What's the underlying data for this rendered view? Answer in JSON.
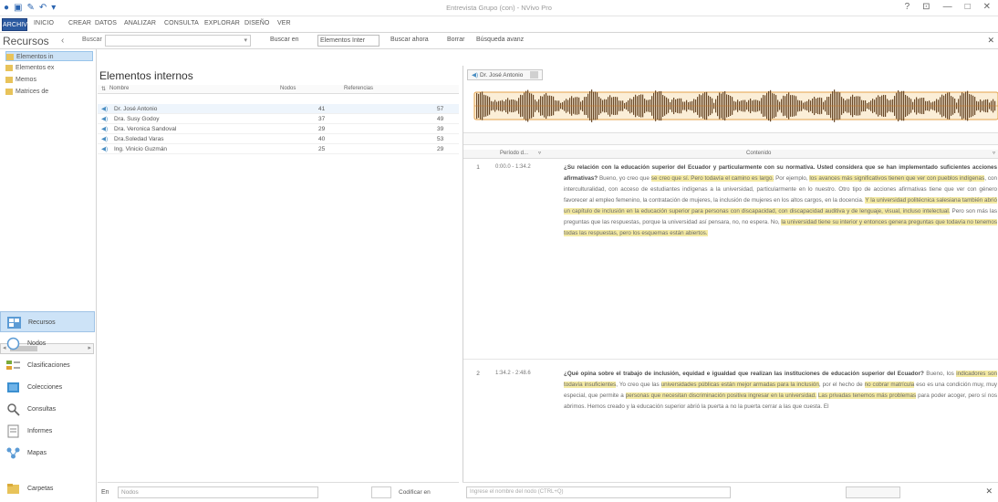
{
  "window": {
    "title": "Entrevista Grupo (con) - NVivo Pro",
    "controls": [
      "?",
      "⊡",
      "—",
      "□",
      "✕"
    ]
  },
  "ribbon": {
    "tabs": [
      "ARCHIVO",
      "INICIO",
      "CREAR",
      "DATOS",
      "ANALIZAR",
      "CONSULTA",
      "EXPLORAR",
      "DISEÑO",
      "VER"
    ]
  },
  "searchbar": {
    "buscar_label": "Buscar",
    "buscar_en": "Buscar en",
    "scope": "Elementos Inter",
    "buscar_ahora": "Buscar ahora",
    "borrar": "Borrar",
    "avanzada": "Búsqueda avanz"
  },
  "nav": {
    "title": "Recursos",
    "tree": [
      "Elementos in",
      "Elementos ex",
      "Memos",
      "Matrices de"
    ],
    "buttons": [
      "Recursos",
      "Nodos",
      "Clasificaciones",
      "Colecciones",
      "Consultas",
      "Informes",
      "Mapas",
      "Carpetas"
    ]
  },
  "list": {
    "title": "Elementos internos",
    "columns": [
      "Nombre",
      "Nodos",
      "Referencias"
    ],
    "rows": [
      {
        "name": "Dr. José Antonio",
        "nodes": "41",
        "refs": "57"
      },
      {
        "name": "Dra. Susy Godoy",
        "nodes": "37",
        "refs": "49"
      },
      {
        "name": "Dra. Veronica Sandoval",
        "nodes": "29",
        "refs": "39"
      },
      {
        "name": "Dra.Soledad Varas",
        "nodes": "40",
        "refs": "53"
      },
      {
        "name": "Ing. Vinicio Guzmán",
        "nodes": "25",
        "refs": "29"
      }
    ],
    "footer": {
      "en_label": "En",
      "field": "Nodos",
      "codificar": "Codificar en"
    }
  },
  "detail": {
    "tab": "Dr. José Antonio",
    "columns": [
      "Período d...",
      "Contenido"
    ],
    "segments": [
      {
        "num": "1",
        "time": "0:00.0 - 1:34.2",
        "parts": [
          {
            "t": "¿Su relación con la educación superior del Ecuador y particularmente con su normativa. Usted considera que se han implementado suficientes acciones afirmativas?",
            "q": true
          },
          {
            "t": " Bueno, yo creo que ",
            "h": false
          },
          {
            "t": "se creo que sí. Pero todavía el camino es largo.",
            "h": true
          },
          {
            "t": " Por ejemplo, ",
            "h": false
          },
          {
            "t": "los avances más significativos tienen que ver con pueblos indígenas",
            "h": true
          },
          {
            "t": ", con interculturalidad, con acceso de estudiantes indígenas a la universidad, particularmente en lo nuestro. Otro tipo de acciones afirmativas tiene que ver con género favorecer al empleo femenino, la contratación de mujeres, la inclusión de mujeres en los altos cargos, en la docencia. ",
            "h": false
          },
          {
            "t": "Y la universidad politécnica salesiana también abrió un capítulo de inclusión en la educación superior para personas con discapacidad, con discapacidad auditiva y de lenguaje, visual, incluso intelectual.",
            "h": true
          },
          {
            "t": " Pero son más las preguntas que las respuestas, porque la universidad así pensara, no, no espera. No, ",
            "h": false
          },
          {
            "t": "la universidad tiene su interior y entonces genera preguntas que todavía no tenemos todas las respuestas, pero los esquemas están abiertos.",
            "h": true
          }
        ]
      },
      {
        "num": "2",
        "time": "1:34.2 - 2:48.6",
        "parts": [
          {
            "t": "¿Qué opina sobre el trabajo de inclusión, equidad e igualdad que realizan las instituciones de educación superior del Ecuador?",
            "q": true
          },
          {
            "t": " Bueno, los ",
            "h": false
          },
          {
            "t": "indicadores son todavía insuficientes",
            "h": true
          },
          {
            "t": ", Yo creo que las ",
            "h": false
          },
          {
            "t": "universidades públicas están mejor armadas para la inclusión",
            "h": true
          },
          {
            "t": ", por el hecho de ",
            "h": false
          },
          {
            "t": "no cobrar matrícula",
            "h": true
          },
          {
            "t": " eso es una condición muy, muy especial, que permite a ",
            "h": false
          },
          {
            "t": "personas que necesitan discriminación positiva ingresar en la universidad.",
            "h": true
          },
          {
            "t": " ",
            "h": false
          },
          {
            "t": "Las privadas tenemos más problemas",
            "h": true
          },
          {
            "t": " para poder acoger, pero sí nos abrimos. Hemos creado y la educación superior abrió la puerta a no la puerta cerrar a las que cuesta. El",
            "h": false
          }
        ]
      }
    ],
    "footer": {
      "hint": "Ingrese el nombre del nodo (CTRL+Q)"
    }
  }
}
